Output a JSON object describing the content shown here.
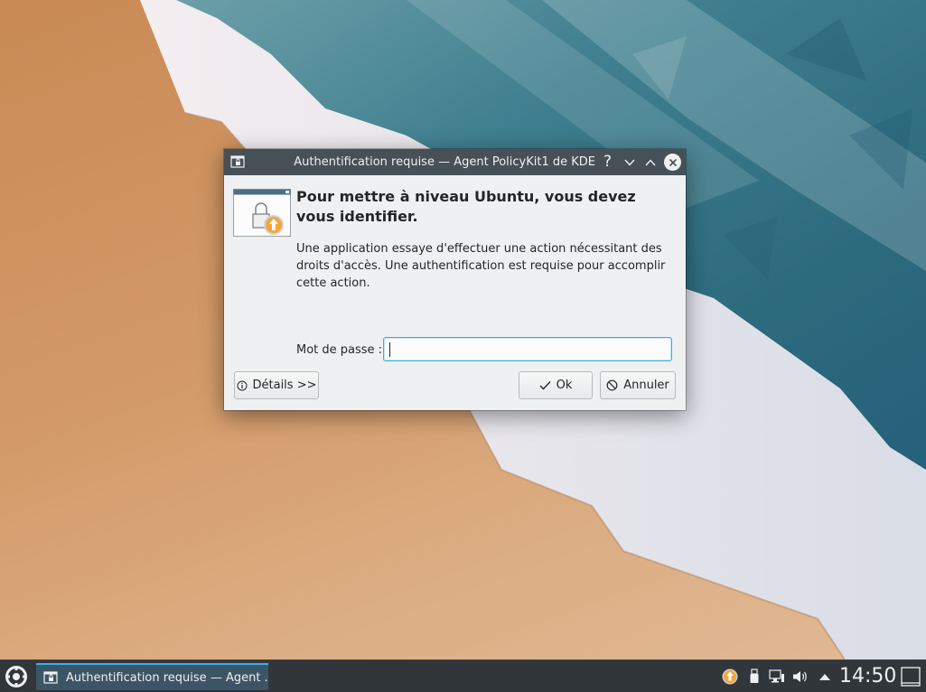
{
  "window": {
    "title": "Authentification requise — Agent PolicyKit1 de KDE",
    "help_glyph": "?"
  },
  "dialog": {
    "heading": "Pour mettre à niveau Ubuntu, vous devez vous identifier.",
    "description": "Une application essaye d'effectuer une action nécessitant des droits d'accès. Une authentification est requise pour accomplir cette action.",
    "password_label": "Mot de passe :",
    "password_value": ""
  },
  "buttons": {
    "details": "Détails >>",
    "ok": "Ok",
    "cancel": "Annuler"
  },
  "taskbar": {
    "task_label": "Authentification requise — Agent ...",
    "clock": "14:50"
  },
  "colors": {
    "accent": "#3daee9",
    "titlebar": "#475057",
    "panel": "#31363b",
    "window_bg": "#eff0f1",
    "update_badge": "#f3a63c"
  },
  "icons": {
    "launcher": "kde-launcher-icon",
    "dialog": "lock-update-icon",
    "tray": [
      "software-update-icon",
      "usb-device-icon",
      "network-icon",
      "volume-icon",
      "expand-tray-icon"
    ]
  }
}
